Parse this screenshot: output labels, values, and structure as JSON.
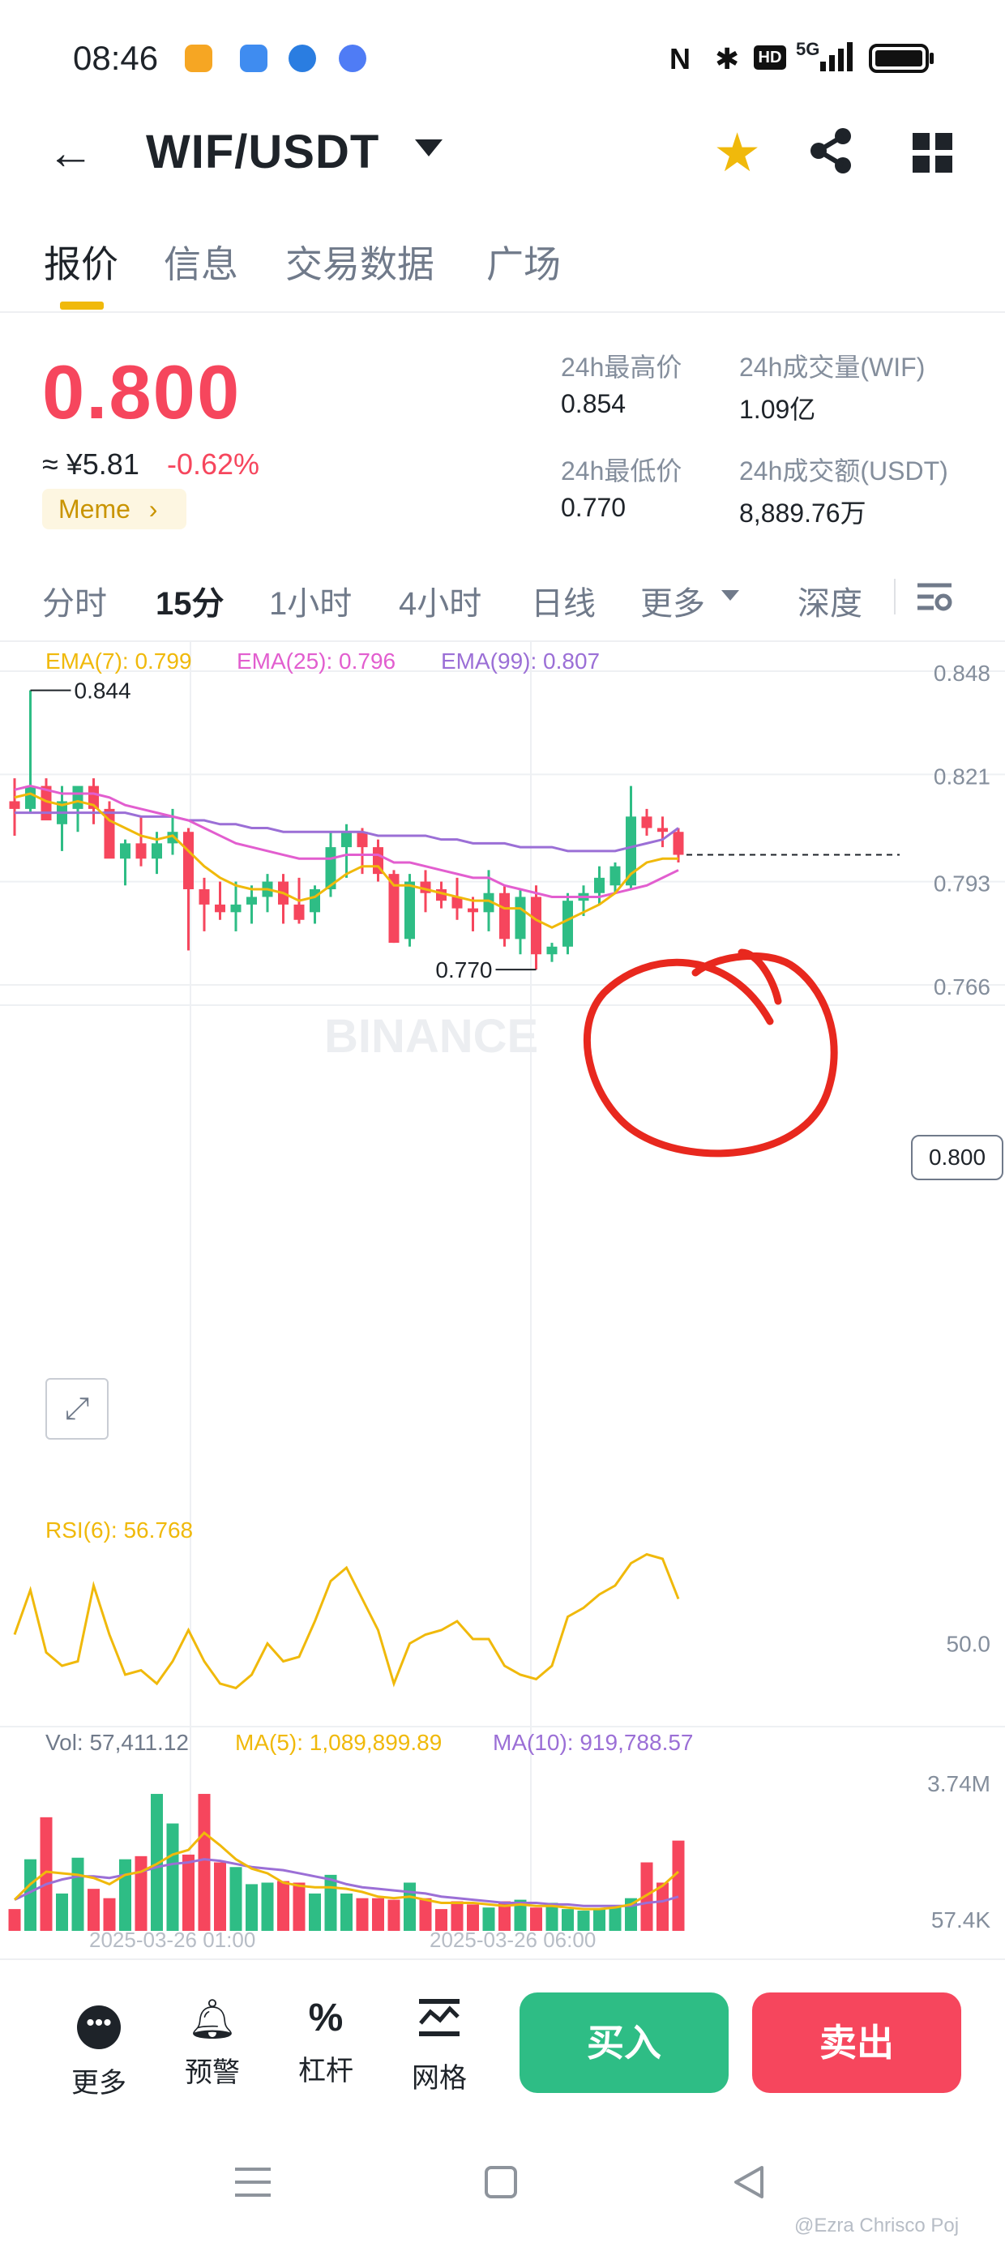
{
  "status_bar": {
    "time": "08:46",
    "network": "5G"
  },
  "header": {
    "title": "WIF/USDT"
  },
  "tabs": [
    "报价",
    "信息",
    "交易数据",
    "广场"
  ],
  "ticker": {
    "price": "0.800",
    "cny": "≈ ¥5.81",
    "change": "-0.62%",
    "tag": "Meme",
    "stats": [
      {
        "label": "24h最高价",
        "value": "0.854"
      },
      {
        "label": "24h成交量(WIF)",
        "value": "1.09亿"
      },
      {
        "label": "24h最低价",
        "value": "0.770"
      },
      {
        "label": "24h成交额(USDT)",
        "value": "8,889.76万"
      }
    ]
  },
  "timeframes": [
    "分时",
    "15分",
    "1小时",
    "4小时",
    "日线",
    "更多",
    "深度"
  ],
  "chart": {
    "watermark": "BINANCE",
    "ema_labels": [
      "EMA(7): 0.799",
      "EMA(25): 0.796",
      "EMA(99): 0.807"
    ],
    "price_axis": [
      "0.848",
      "0.821",
      "0.793",
      "0.766"
    ],
    "current_price_tag": "0.800",
    "high_label": "0.844",
    "low_label": "0.770",
    "rsi_label": "RSI(6): 56.768",
    "rsi_axis": "50.0",
    "vol_label": "Vol: 57,411.12",
    "vol_ma5": "MA(5): 1,089,899.89",
    "vol_ma10": "MA(10): 919,788.57",
    "vol_axis": [
      "3.74M",
      "57.4K"
    ],
    "time_labels": [
      "2025-03-26 01:00",
      "2025-03-26 06:00"
    ],
    "colors": {
      "up": "#2ebd85",
      "down": "#f6465d",
      "ema7": "#f0b90b",
      "ema25": "#e25ecf",
      "ema99": "#9b6fd6",
      "annotation": "#e8281e"
    }
  },
  "chart_data": {
    "type": "candlestick",
    "ylim": [
      0.766,
      0.848
    ],
    "candles": [
      {
        "o": 0.814,
        "h": 0.82,
        "l": 0.805,
        "c": 0.812
      },
      {
        "o": 0.812,
        "h": 0.843,
        "l": 0.811,
        "c": 0.818
      },
      {
        "o": 0.818,
        "h": 0.82,
        "l": 0.811,
        "c": 0.809
      },
      {
        "o": 0.808,
        "h": 0.818,
        "l": 0.801,
        "c": 0.814
      },
      {
        "o": 0.812,
        "h": 0.815,
        "l": 0.806,
        "c": 0.818
      },
      {
        "o": 0.818,
        "h": 0.82,
        "l": 0.808,
        "c": 0.812
      },
      {
        "o": 0.812,
        "h": 0.814,
        "l": 0.8,
        "c": 0.799
      },
      {
        "o": 0.799,
        "h": 0.804,
        "l": 0.792,
        "c": 0.803
      },
      {
        "o": 0.803,
        "h": 0.81,
        "l": 0.797,
        "c": 0.799
      },
      {
        "o": 0.799,
        "h": 0.806,
        "l": 0.795,
        "c": 0.803
      },
      {
        "o": 0.803,
        "h": 0.812,
        "l": 0.8,
        "c": 0.806
      },
      {
        "o": 0.806,
        "h": 0.807,
        "l": 0.775,
        "c": 0.791
      },
      {
        "o": 0.791,
        "h": 0.794,
        "l": 0.78,
        "c": 0.787
      },
      {
        "o": 0.787,
        "h": 0.793,
        "l": 0.783,
        "c": 0.785
      },
      {
        "o": 0.785,
        "h": 0.793,
        "l": 0.78,
        "c": 0.787
      },
      {
        "o": 0.787,
        "h": 0.792,
        "l": 0.782,
        "c": 0.789
      },
      {
        "o": 0.789,
        "h": 0.795,
        "l": 0.785,
        "c": 0.793
      },
      {
        "o": 0.793,
        "h": 0.795,
        "l": 0.782,
        "c": 0.787
      },
      {
        "o": 0.787,
        "h": 0.794,
        "l": 0.782,
        "c": 0.783
      },
      {
        "o": 0.785,
        "h": 0.792,
        "l": 0.782,
        "c": 0.791
      },
      {
        "o": 0.791,
        "h": 0.806,
        "l": 0.789,
        "c": 0.802
      },
      {
        "o": 0.802,
        "h": 0.808,
        "l": 0.794,
        "c": 0.806
      },
      {
        "o": 0.806,
        "h": 0.807,
        "l": 0.795,
        "c": 0.802
      },
      {
        "o": 0.802,
        "h": 0.804,
        "l": 0.793,
        "c": 0.795
      },
      {
        "o": 0.795,
        "h": 0.796,
        "l": 0.777,
        "c": 0.777
      },
      {
        "o": 0.778,
        "h": 0.795,
        "l": 0.776,
        "c": 0.793
      },
      {
        "o": 0.793,
        "h": 0.796,
        "l": 0.785,
        "c": 0.79
      },
      {
        "o": 0.791,
        "h": 0.793,
        "l": 0.786,
        "c": 0.788
      },
      {
        "o": 0.789,
        "h": 0.794,
        "l": 0.783,
        "c": 0.786
      },
      {
        "o": 0.786,
        "h": 0.789,
        "l": 0.78,
        "c": 0.785
      },
      {
        "o": 0.785,
        "h": 0.796,
        "l": 0.78,
        "c": 0.79
      },
      {
        "o": 0.79,
        "h": 0.792,
        "l": 0.776,
        "c": 0.778
      },
      {
        "o": 0.778,
        "h": 0.791,
        "l": 0.774,
        "c": 0.789
      },
      {
        "o": 0.789,
        "h": 0.792,
        "l": 0.77,
        "c": 0.774
      },
      {
        "o": 0.774,
        "h": 0.777,
        "l": 0.772,
        "c": 0.776
      },
      {
        "o": 0.776,
        "h": 0.79,
        "l": 0.774,
        "c": 0.788
      },
      {
        "o": 0.788,
        "h": 0.792,
        "l": 0.784,
        "c": 0.79
      },
      {
        "o": 0.79,
        "h": 0.797,
        "l": 0.787,
        "c": 0.794
      },
      {
        "o": 0.792,
        "h": 0.798,
        "l": 0.79,
        "c": 0.797
      },
      {
        "o": 0.792,
        "h": 0.818,
        "l": 0.791,
        "c": 0.81
      },
      {
        "o": 0.81,
        "h": 0.812,
        "l": 0.805,
        "c": 0.807
      },
      {
        "o": 0.807,
        "h": 0.81,
        "l": 0.802,
        "c": 0.806
      },
      {
        "o": 0.806,
        "h": 0.807,
        "l": 0.798,
        "c": 0.8
      }
    ],
    "ema7": [
      0.815,
      0.816,
      0.814,
      0.813,
      0.814,
      0.813,
      0.809,
      0.807,
      0.805,
      0.804,
      0.805,
      0.801,
      0.797,
      0.794,
      0.792,
      0.791,
      0.791,
      0.79,
      0.788,
      0.789,
      0.792,
      0.795,
      0.797,
      0.797,
      0.792,
      0.792,
      0.791,
      0.79,
      0.789,
      0.788,
      0.788,
      0.786,
      0.786,
      0.783,
      0.781,
      0.783,
      0.785,
      0.787,
      0.79,
      0.795,
      0.798,
      0.799,
      0.799
    ],
    "ema25": [
      0.817,
      0.818,
      0.817,
      0.816,
      0.816,
      0.816,
      0.815,
      0.813,
      0.812,
      0.811,
      0.81,
      0.809,
      0.807,
      0.805,
      0.803,
      0.802,
      0.801,
      0.8,
      0.799,
      0.799,
      0.799,
      0.8,
      0.8,
      0.8,
      0.798,
      0.798,
      0.797,
      0.796,
      0.795,
      0.794,
      0.794,
      0.792,
      0.791,
      0.79,
      0.789,
      0.789,
      0.789,
      0.789,
      0.79,
      0.791,
      0.792,
      0.794,
      0.796
    ],
    "ema99": [
      0.811,
      0.811,
      0.811,
      0.811,
      0.811,
      0.811,
      0.811,
      0.811,
      0.81,
      0.81,
      0.81,
      0.809,
      0.809,
      0.808,
      0.808,
      0.807,
      0.807,
      0.806,
      0.806,
      0.806,
      0.806,
      0.806,
      0.806,
      0.805,
      0.805,
      0.805,
      0.805,
      0.804,
      0.804,
      0.803,
      0.803,
      0.803,
      0.802,
      0.802,
      0.802,
      0.801,
      0.801,
      0.801,
      0.801,
      0.802,
      0.803,
      0.804,
      0.807
    ],
    "rsi": [
      52,
      62,
      48,
      45,
      46,
      63,
      52,
      43,
      44,
      41,
      46,
      53,
      46,
      41,
      40,
      43,
      50,
      46,
      47,
      55,
      64,
      67,
      60,
      53,
      41,
      50,
      52,
      53,
      55,
      51,
      51,
      45,
      43,
      42,
      45,
      56,
      58,
      61,
      63,
      68,
      70,
      69,
      60
    ],
    "rsi_range": [
      35,
      75
    ],
    "volume": [
      0.14,
      0.46,
      0.73,
      0.24,
      0.47,
      0.27,
      0.21,
      0.46,
      0.48,
      0.88,
      0.69,
      0.49,
      0.88,
      0.44,
      0.41,
      0.3,
      0.31,
      0.32,
      0.31,
      0.24,
      0.36,
      0.24,
      0.21,
      0.21,
      0.2,
      0.31,
      0.21,
      0.14,
      0.19,
      0.17,
      0.15,
      0.19,
      0.2,
      0.15,
      0.18,
      0.14,
      0.13,
      0.14,
      0.16,
      0.21,
      0.44,
      0.31,
      0.58
    ],
    "vol_ma5": [
      0.2,
      0.3,
      0.38,
      0.37,
      0.36,
      0.34,
      0.3,
      0.36,
      0.38,
      0.43,
      0.49,
      0.52,
      0.63,
      0.55,
      0.46,
      0.4,
      0.37,
      0.31,
      0.29,
      0.28,
      0.28,
      0.27,
      0.25,
      0.22,
      0.21,
      0.22,
      0.2,
      0.18,
      0.18,
      0.18,
      0.17,
      0.16,
      0.17,
      0.16,
      0.16,
      0.15,
      0.14,
      0.14,
      0.15,
      0.17,
      0.23,
      0.29,
      0.38
    ],
    "vol_ma10": [
      0.2,
      0.25,
      0.3,
      0.33,
      0.35,
      0.35,
      0.34,
      0.36,
      0.38,
      0.41,
      0.43,
      0.44,
      0.46,
      0.45,
      0.43,
      0.41,
      0.4,
      0.39,
      0.37,
      0.35,
      0.33,
      0.3,
      0.28,
      0.27,
      0.26,
      0.25,
      0.24,
      0.22,
      0.21,
      0.2,
      0.19,
      0.18,
      0.18,
      0.18,
      0.17,
      0.17,
      0.16,
      0.16,
      0.16,
      0.16,
      0.18,
      0.19,
      0.22
    ],
    "vol_range": [
      0,
      1
    ]
  },
  "bottom_bar": {
    "actions": [
      {
        "label": "更多",
        "icon": "more-icon"
      },
      {
        "label": "预警",
        "icon": "bell-icon"
      },
      {
        "label": "杠杆",
        "icon": "leverage-icon"
      },
      {
        "label": "网格",
        "icon": "grid-trading-icon"
      }
    ],
    "buy": "买入",
    "sell": "卖出"
  },
  "watermark_text": "@Ezra Chrisco Poj"
}
